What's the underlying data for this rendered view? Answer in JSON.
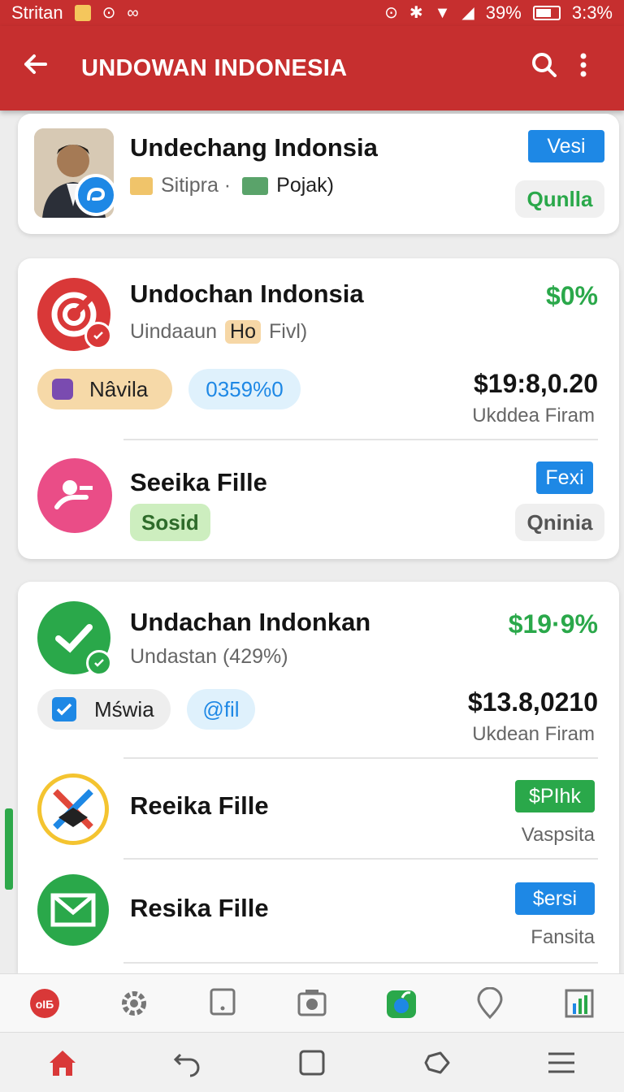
{
  "status_bar": {
    "carrier": "Stritan",
    "battery_percent": "39%",
    "time": "3:3%"
  },
  "app_bar": {
    "title": "UNDOWAN INDONESIA"
  },
  "card1": {
    "name": "Undechang Indonsia",
    "sub_a": "Sitipra ·",
    "sub_b": "Pojak)",
    "tag": "Vesi",
    "chip": "Qunlla"
  },
  "card2": {
    "row1": {
      "name": "Undochan Indonsia",
      "sub_a": "Uindaaun",
      "sub_highlight": "Ho",
      "sub_b": "Fivl)",
      "percent": "$0%",
      "pill1": "Nâvila",
      "pill2": "0359%0",
      "amount": "$19:8,0.20",
      "amount_label": "Ukddea Firam"
    },
    "row2": {
      "name": "Seeika Fille",
      "chip_left": "Sosid",
      "tag": "Fexi",
      "chip_right": "Qninia"
    }
  },
  "card3": {
    "row1": {
      "name": "Undachan Indonkan",
      "sub": "Undastan (429%)",
      "percent": "$19·9%",
      "pill1": "Mświa",
      "pill2": "@fil",
      "amount": "$13.8,0210",
      "amount_label": "Ukdean Firam"
    },
    "row2": {
      "name": "Reeika Fille",
      "tag": "$PIhk",
      "label": "Vaspsita"
    },
    "row3": {
      "name": "Resika Fille",
      "tag": "$ersi",
      "label": "Fansita"
    }
  },
  "tab_icons": [
    "brand-icon",
    "settings-icon",
    "tablet-icon",
    "camera-icon",
    "apple-icon",
    "location-icon",
    "chart-icon"
  ],
  "nav_icons": [
    "home-icon",
    "back-gesture-icon",
    "recents-icon",
    "rotate-icon",
    "menu-icon"
  ],
  "colors": {
    "brand_red": "#c62f2f",
    "green": "#2aa84a",
    "blue": "#1e88e5",
    "pink": "#ea4d87"
  }
}
